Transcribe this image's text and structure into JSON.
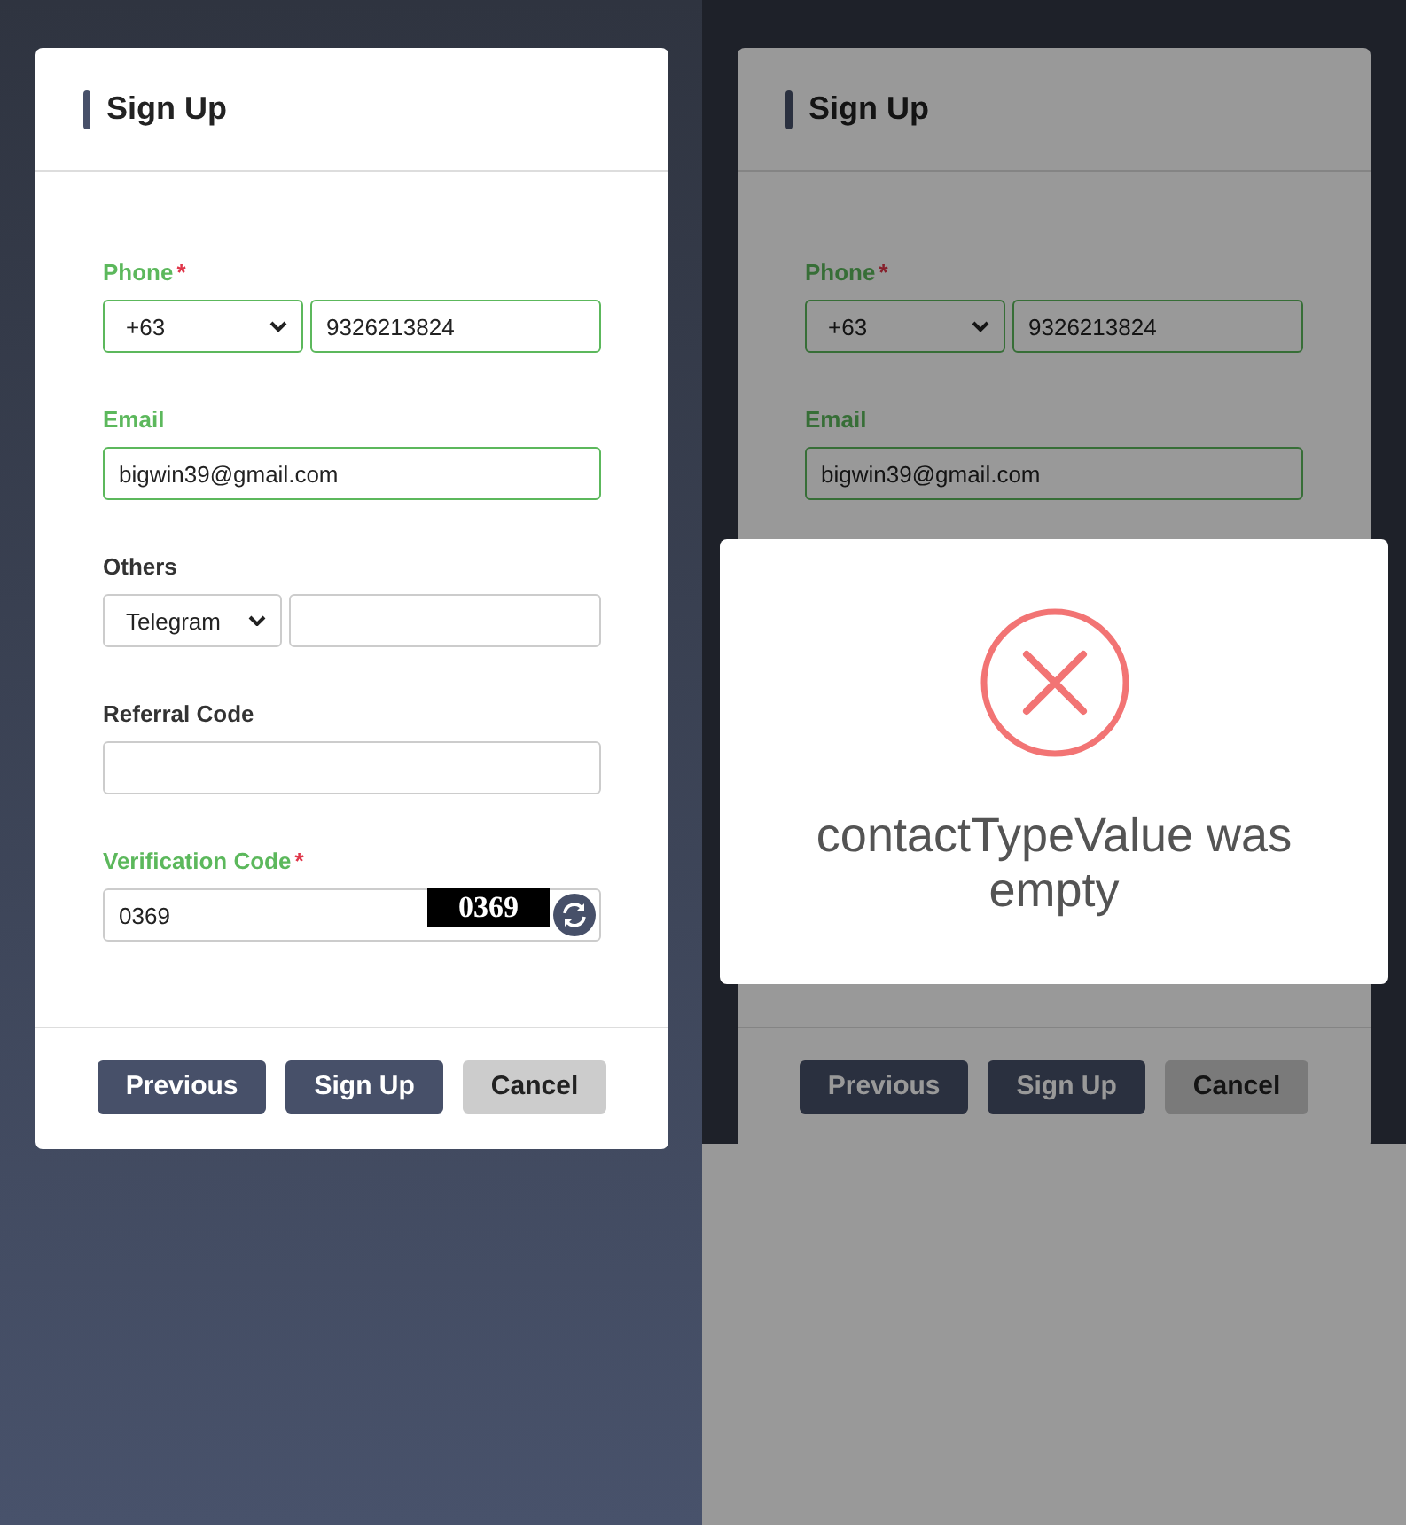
{
  "left_panel": {
    "title": "Sign Up",
    "fields": [
      {
        "kind": "phone",
        "label": "Phone",
        "required_mark": "*",
        "valid": true,
        "select": "+63",
        "value": "9326213824",
        "input_valid": true
      },
      {
        "kind": "text",
        "label": "Email",
        "valid": true,
        "value": "bigwin39@gmail.com",
        "input_valid": true
      },
      {
        "kind": "select_text",
        "label": "Others",
        "valid": false,
        "select": "Telegram",
        "input_valid": false
      },
      {
        "kind": "text",
        "label": "Referral Code",
        "valid": false,
        "input_valid": false
      },
      {
        "kind": "captcha",
        "label": "Verification Code",
        "required_mark": "*",
        "valid": true,
        "value": "0369",
        "captcha": "0369",
        "input_valid": false
      }
    ],
    "buttons": [
      {
        "label": "Previous",
        "kind": "primary"
      },
      {
        "label": "Sign Up",
        "kind": "primary"
      },
      {
        "label": "Cancel",
        "kind": "secondary"
      }
    ]
  },
  "right_panel": {
    "title": "Sign Up",
    "fields": [
      {
        "kind": "phone",
        "label": "Phone",
        "required_mark": "*",
        "valid": true,
        "select": "+63",
        "value": "9326213824",
        "input_valid": true
      },
      {
        "kind": "text",
        "label": "Email",
        "valid": true,
        "value": "bigwin39@gmail.com",
        "input_valid": true
      }
    ],
    "buttons": [
      {
        "label": "Previous",
        "kind": "primary"
      },
      {
        "label": "Sign Up",
        "kind": "primary"
      },
      {
        "label": "Cancel",
        "kind": "secondary"
      }
    ],
    "alert": {
      "kind": "error",
      "message": "contactTypeValue was empty"
    }
  }
}
